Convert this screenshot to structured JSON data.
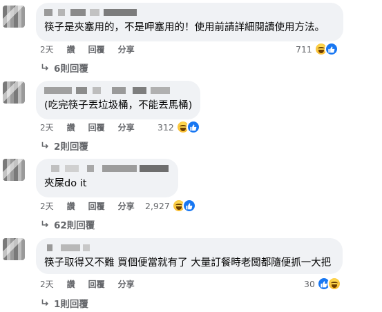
{
  "comments": [
    {
      "text": "筷子是夾塞用的，不是呷塞用的！使用前請詳細閱讀使用方法。",
      "time": "2天",
      "like_label": "讚",
      "reply_label": "回覆",
      "share_label": "分享",
      "reaction_count": "711",
      "reactions": [
        "haha-icon",
        "like-icon"
      ],
      "replies_label": "6則回覆"
    },
    {
      "text": "(吃完筷子丟垃圾桶，不能丟馬桶)",
      "time": "2天",
      "like_label": "讚",
      "reply_label": "回覆",
      "share_label": "分享",
      "reaction_count": "312",
      "reactions": [
        "haha-icon",
        "like-icon"
      ],
      "replies_label": "2則回覆"
    },
    {
      "text": "夾屎do it",
      "time": "2天",
      "like_label": "讚",
      "reply_label": "回覆",
      "share_label": "分享",
      "reaction_count": "2,927",
      "reactions": [
        "haha-icon",
        "like-icon"
      ],
      "replies_label": "62則回覆"
    },
    {
      "text": "筷子取得又不難 買個便當就有了 大量訂餐時老闆都隨便抓一大把",
      "time": "2天",
      "like_label": "讚",
      "reply_label": "回覆",
      "share_label": "分享",
      "reaction_count": "30",
      "reactions": [
        "like-icon",
        "haha-icon"
      ],
      "replies_label": "1則回覆"
    }
  ],
  "colors": {
    "bubble": "#f0f2f5",
    "secondary_text": "#65676b",
    "like_blue": "#1877f2",
    "haha_yellow": "#f7b125"
  }
}
